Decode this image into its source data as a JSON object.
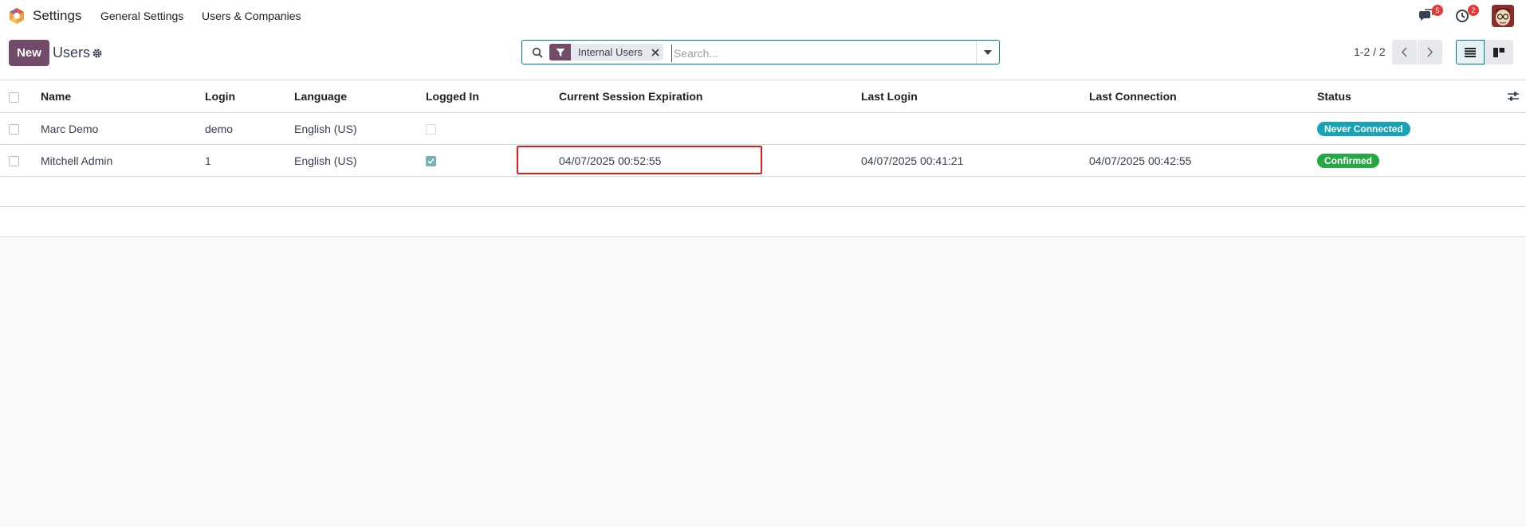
{
  "topbar": {
    "app_name": "Settings",
    "menu": [
      "General Settings",
      "Users & Companies"
    ],
    "messages_count": "5",
    "activities_count": "2"
  },
  "control": {
    "new_label": "New",
    "title": "Users",
    "facet_label": "Internal Users",
    "search_placeholder": "Search...",
    "pager": "1-2 / 2"
  },
  "table": {
    "columns": [
      "Name",
      "Login",
      "Language",
      "Logged In",
      "Current Session Expiration",
      "Last Login",
      "Last Connection",
      "Status"
    ],
    "rows": [
      {
        "name": "Marc Demo",
        "login": "demo",
        "language": "English (US)",
        "logged_in": false,
        "session_expiration": "",
        "last_login": "",
        "last_connection": "",
        "status": "Never Connected",
        "status_color": "#17a2b8"
      },
      {
        "name": "Mitchell Admin",
        "login": "1",
        "language": "English (US)",
        "logged_in": true,
        "session_expiration": "04/07/2025 00:52:55",
        "last_login": "04/07/2025 00:41:21",
        "last_connection": "04/07/2025 00:42:55",
        "status": "Confirmed",
        "status_color": "#28a745"
      }
    ]
  },
  "colors": {
    "brand": "#714B67",
    "accent": "#017e84",
    "highlight": "#e01b1b"
  },
  "icons": [
    "odoo-logo",
    "settings-gear-icon",
    "search-icon",
    "filter-icon",
    "close-icon",
    "caret-down-icon",
    "chevron-left-icon",
    "chevron-right-icon",
    "list-view-icon",
    "kanban-view-icon",
    "chat-icon",
    "clock-icon",
    "column-settings-icon"
  ]
}
